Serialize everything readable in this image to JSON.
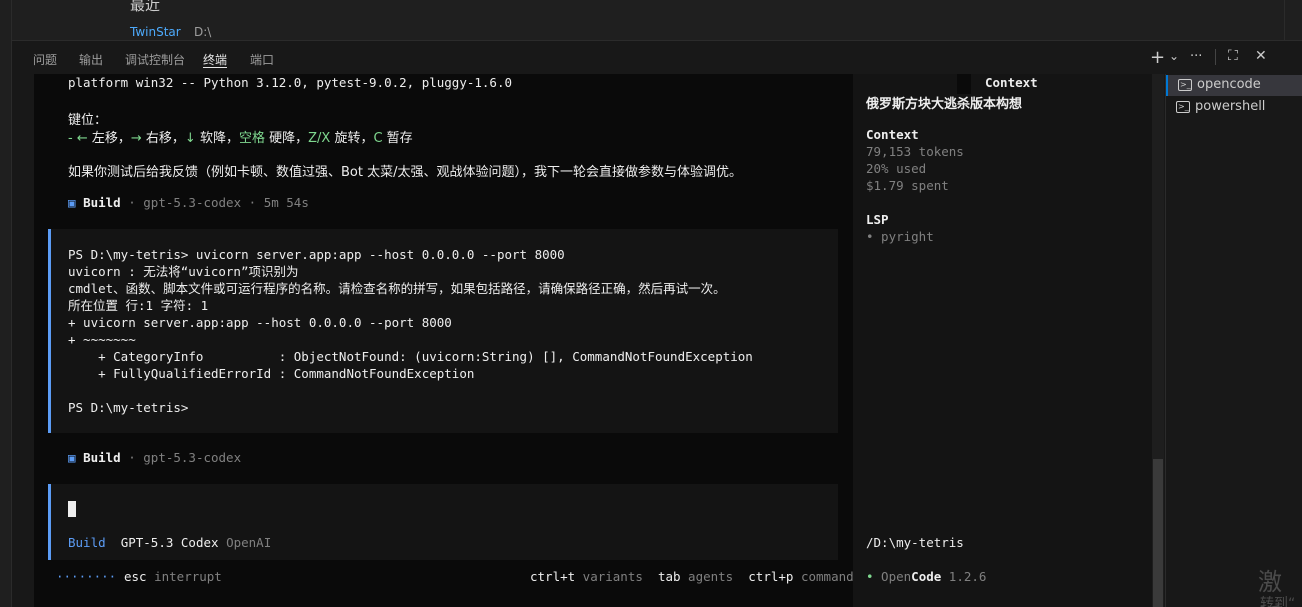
{
  "top": {
    "title": "最近",
    "recent_item": "TwinStar",
    "recent_path": "D:\\"
  },
  "panel_tabs": [
    "问题",
    "输出",
    "调试控制台",
    "终端",
    "端口"
  ],
  "toolbar": {
    "new_terminal": "+",
    "dropdown": "⌄",
    "more": "···",
    "maximize": "⛶",
    "close": "✕"
  },
  "terminal": {
    "header_line": "platform win32 -- Python 3.12.0, pytest-9.0.2, pluggy-1.6.0",
    "keys_label": "键位：",
    "keys_line": {
      "p1": "- ",
      "left_key": "←",
      "left_text": " 左移，",
      "right_key": "→",
      "right_text": " 右移，",
      "down_key": "↓",
      "down_text": " 软降，",
      "space_key": "空格",
      "space_text": " 硬降，",
      "rotate_key": "Z/X",
      "rotate_text": " 旋转，",
      "pause_key": "C",
      "pause_text": " 暂存"
    },
    "feedback_line": "如果你测试后给我反馈（例如卡顿、数值过强、Bot 太菜/太强、观战体验问题），我下一轮会直接做参数与体验调优。",
    "build1": {
      "icon": "▣",
      "label": "Build",
      "meta": " · gpt-5.3-codex · 5m 54s"
    },
    "error_block": [
      "PS D:\\my-tetris> uvicorn server.app:app --host 0.0.0.0 --port 8000",
      "uvicorn : 无法将“uvicorn”项识别为",
      "cmdlet、函数、脚本文件或可运行程序的名称。请检查名称的拼写，如果包括路径，请确保路径正确，然后再试一次。",
      "所在位置 行:1 字符: 1",
      "+ uvicorn server.app:app --host 0.0.0.0 --port 8000",
      "+ ~~~~~~~",
      "    + CategoryInfo          : ObjectNotFound: (uvicorn:String) [], CommandNotFoundException",
      "    + FullyQualifiedErrorId : CommandNotFoundException",
      "",
      "PS D:\\my-tetris>"
    ],
    "build2": {
      "icon": "▣",
      "label": "Build",
      "meta": " · gpt-5.3-codex"
    },
    "input": {
      "mode": "Build",
      "model": "GPT-5.3 Codex",
      "provider": "OpenAI"
    },
    "footer": {
      "dots": "········",
      "esc_key": "esc",
      "esc_text": " interrupt",
      "variants_key": "ctrl+t",
      "variants_text": " variants",
      "agents_key": "tab",
      "agents_text": " agents",
      "commands_key": "ctrl+p",
      "commands_text": " commands"
    }
  },
  "sidebar": {
    "top_label": "Context",
    "title": "俄罗斯方块大逃杀版本构想",
    "context_heading": "Context",
    "tokens": "79,153 tokens",
    "used": "20% used",
    "spent": "$1.79 spent",
    "lsp_heading": "LSP",
    "lsp_item": "• pyright",
    "path": "/D:\\my-tetris",
    "brand_dot": "•",
    "brand_open": " Open",
    "brand_code": "Code",
    "version": " 1.2.6"
  },
  "terminal_list": [
    {
      "label": "opencode",
      "icon": "terminal-icon"
    },
    {
      "label": "powershell",
      "icon": "terminal-icon"
    }
  ],
  "watermark": {
    "line1": "激活",
    "line2": "转到“"
  }
}
